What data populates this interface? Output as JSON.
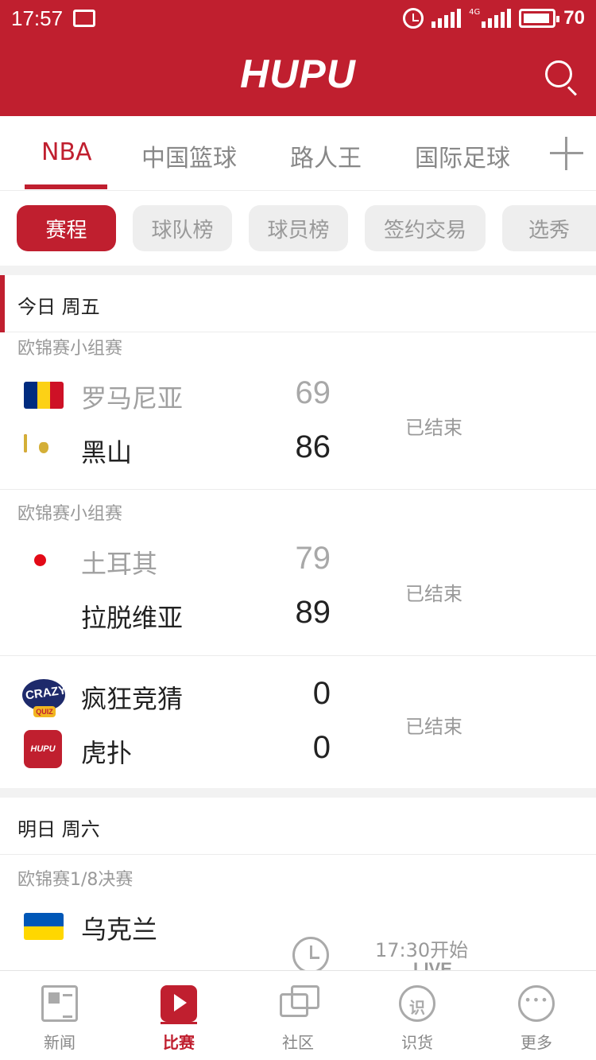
{
  "status_bar": {
    "time": "17:57",
    "battery": "70",
    "network": "4G"
  },
  "header": {
    "logo": "HUPU"
  },
  "top_tabs": [
    "NBA",
    "中国篮球",
    "路人王",
    "国际足球"
  ],
  "sub_tabs": [
    "赛程",
    "球队榜",
    "球员榜",
    "签约交易",
    "选秀"
  ],
  "days": [
    {
      "label": "今日 周五",
      "matches": [
        {
          "league": "欧锦赛小组赛",
          "status": "已结束",
          "home": {
            "name": "罗马尼亚",
            "score": "69",
            "flag": "romania-flag"
          },
          "away": {
            "name": "黑山",
            "score": "86",
            "flag": "montenegro-flag"
          }
        },
        {
          "league": "欧锦赛小组赛",
          "status": "已结束",
          "home": {
            "name": "土耳其",
            "score": "79",
            "flag": "turkey-flag"
          },
          "away": {
            "name": "拉脱维亚",
            "score": "89",
            "flag": "latvia-flag"
          }
        },
        {
          "league": "",
          "status": "已结束",
          "home": {
            "name": "疯狂竞猜",
            "score": "0",
            "flag": "crazy-quiz-logo",
            "logo_text": "CRAZY",
            "logo_sub": "QUIZ"
          },
          "away": {
            "name": "虎扑",
            "score": "0",
            "flag": "hupu-logo",
            "logo_text": "HUPU"
          }
        }
      ]
    },
    {
      "label": "明日 周六",
      "matches": [
        {
          "league": "欧锦赛1/8决赛",
          "status": "17:30开始",
          "live": "LIVE",
          "home": {
            "name": "乌克兰",
            "flag": "ukraine-flag"
          }
        }
      ]
    }
  ],
  "bottom_nav": [
    "新闻",
    "比赛",
    "社区",
    "识货",
    "更多"
  ],
  "bottom_nav_active": "比赛",
  "shihuo_glyph": "识",
  "colors": {
    "brand": "#c01f2f",
    "muted": "#999999",
    "divider": "#ececec"
  }
}
